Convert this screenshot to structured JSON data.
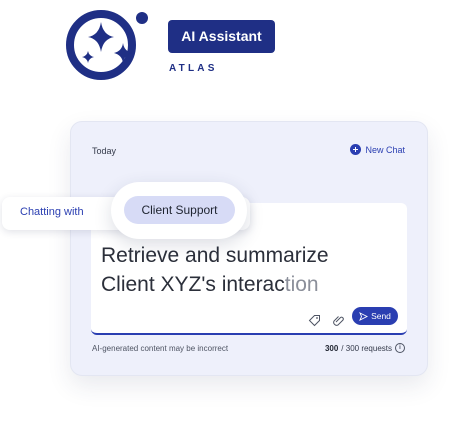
{
  "brand": {
    "badge": "AI Assistant",
    "subtitle": "ATLAS",
    "logo_icon": "sparkles-icon",
    "color": "#1f2f85"
  },
  "card": {
    "date_label": "Today",
    "new_chat": "New Chat",
    "prompt_main": "Retrieve and summarize",
    "prompt_line2_main": "Client XYZ's interac",
    "prompt_line2_fade": "tion",
    "send_label": "Send",
    "disclaimer": "AI-generated content may be incorrect",
    "quota_used": "300",
    "quota_suffix": "/ 300 requests",
    "accent": "#2a3eb1"
  },
  "chat_context": {
    "label": "Chatting with",
    "target": "Client Support"
  }
}
